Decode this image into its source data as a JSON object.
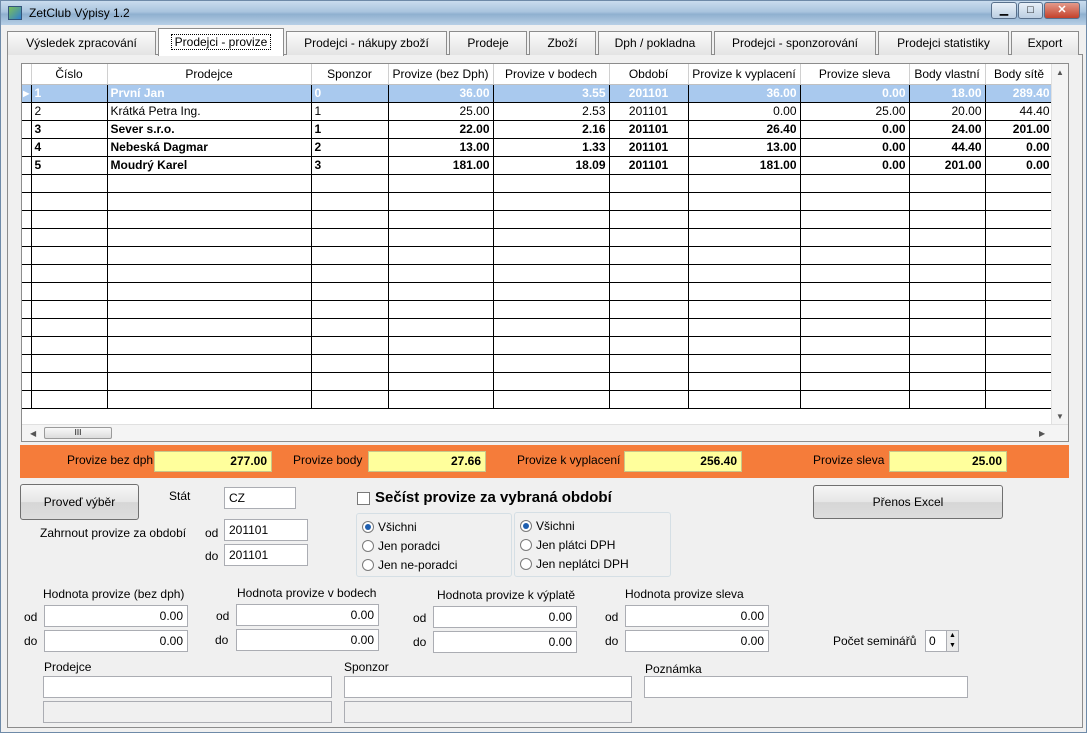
{
  "window": {
    "title": "ZetClub Výpisy 1.2",
    "btn_min": "▁",
    "btn_max": "□",
    "btn_close": "✕"
  },
  "tabs": [
    "Výsledek zpracování",
    "Prodejci - provize",
    "Prodejci - nákupy zboží",
    "Prodeje",
    "Zboží",
    "Dph / pokladna",
    "Prodejci - sponzorování",
    "Prodejci statistiky",
    "Export"
  ],
  "grid": {
    "columns": [
      "Číslo",
      "Prodejce",
      "Sponzor",
      "Provize (bez Dph)",
      "Provize v bodech",
      "Období",
      "Provize k vyplacení",
      "Provize sleva",
      "Body vlastní",
      "Body sítě"
    ],
    "rows": [
      [
        "1",
        "První Jan",
        "0",
        "36.00",
        "3.55",
        "201101",
        "36.00",
        "0.00",
        "18.00",
        "289.40"
      ],
      [
        "2",
        "Krátká Petra  Ing.",
        "1",
        "25.00",
        "2.53",
        "201101",
        "0.00",
        "25.00",
        "20.00",
        "44.40"
      ],
      [
        "3",
        "Sever s.r.o.",
        "1",
        "22.00",
        "2.16",
        "201101",
        "26.40",
        "0.00",
        "24.00",
        "201.00"
      ],
      [
        "4",
        "Nebeská Dagmar",
        "2",
        "13.00",
        "1.33",
        "201101",
        "13.00",
        "0.00",
        "44.40",
        "0.00"
      ],
      [
        "5",
        "Moudrý Karel",
        "3",
        "181.00",
        "18.09",
        "201101",
        "181.00",
        "0.00",
        "201.00",
        "0.00"
      ]
    ],
    "selected_row": 0,
    "current_row_marker": "▶",
    "hscroll_grip": "III"
  },
  "summary": {
    "provize_bez_dph_label": "Provize bez dph",
    "provize_bez_dph": "277.00",
    "provize_body_label": "Provize body",
    "provize_body": "27.66",
    "provize_k_vyplaceni_label": "Provize k vyplacení",
    "provize_k_vyplaceni": "256.40",
    "provize_sleva_label": "Provize sleva",
    "provize_sleva": "25.00"
  },
  "filters": {
    "proved_vyber": "Proveď výběr",
    "stat_label": "Stát",
    "stat_value": "CZ",
    "zahrnout_label": "Zahrnout provize za období",
    "od_label": "od",
    "do_label": "do",
    "obdobi_od": "201101",
    "obdobi_do": "201101",
    "secist_label": "Sečíst provize za vybraná období",
    "prenos_excel": "Přenos Excel",
    "group1": [
      "Všichni",
      "Jen poradci",
      "Jen ne-poradci"
    ],
    "group2": [
      "Všichni",
      "Jen plátci DPH",
      "Jen neplátci DPH"
    ],
    "hodnota_bez_dph_label": "Hodnota provize (bez dph)",
    "hodnota_bodech_label": "Hodnota provize v bodech",
    "hodnota_vyplate_label": "Hodnota provize k výplatě",
    "hodnota_sleva_label": "Hodnota provize sleva",
    "bez_dph_od": "0.00",
    "bez_dph_do": "0.00",
    "bodech_od": "0.00",
    "bodech_do": "0.00",
    "vyplate_od": "0.00",
    "vyplate_do": "0.00",
    "sleva_od": "0.00",
    "sleva_do": "0.00",
    "pocet_seminaru_label": "Počet seminářů",
    "pocet_seminaru": "0",
    "prodejce_label": "Prodejce",
    "prodejce_value": "",
    "prodejce_value2": "",
    "sponzor_label": "Sponzor",
    "sponzor_value": "",
    "sponzor_value2": "",
    "poznamka_label": "Poznámka",
    "poznamka_value": ""
  },
  "colors": {
    "summary_bar": "#f57c3a",
    "value_bg": "#ffff9c",
    "selected_row": "#a9c9ee"
  },
  "icons": [
    "app-icon",
    "row-pointer-icon",
    "scroll-up-icon",
    "scroll-down-icon",
    "scroll-left-icon",
    "scroll-right-icon",
    "spin-up-icon",
    "spin-down-icon"
  ]
}
